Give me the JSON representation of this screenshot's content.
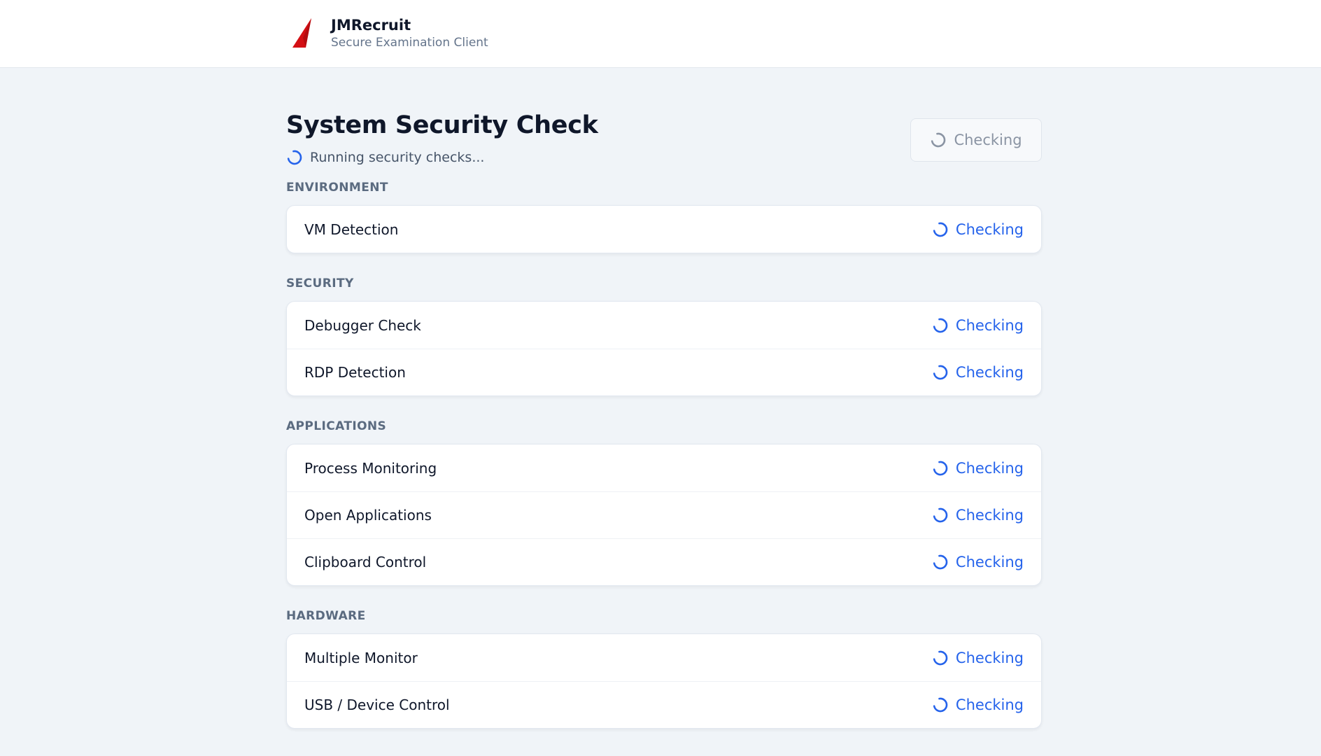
{
  "app": {
    "name": "JMRecruit",
    "subtitle": "Secure Examination Client",
    "logo_color": "#d40f14"
  },
  "page": {
    "title": "System Security Check",
    "status_text": "Running security checks...",
    "check_button_label": "Checking"
  },
  "colors": {
    "accent": "#2563eb",
    "muted": "#8a94a3"
  },
  "sections": [
    {
      "title": "ENVIRONMENT",
      "items": [
        {
          "label": "VM Detection",
          "status": "Checking"
        }
      ]
    },
    {
      "title": "SECURITY",
      "items": [
        {
          "label": "Debugger Check",
          "status": "Checking"
        },
        {
          "label": "RDP Detection",
          "status": "Checking"
        }
      ]
    },
    {
      "title": "APPLICATIONS",
      "items": [
        {
          "label": "Process Monitoring",
          "status": "Checking"
        },
        {
          "label": "Open Applications",
          "status": "Checking"
        },
        {
          "label": "Clipboard Control",
          "status": "Checking"
        }
      ]
    },
    {
      "title": "HARDWARE",
      "items": [
        {
          "label": "Multiple Monitor",
          "status": "Checking"
        },
        {
          "label": "USB / Device Control",
          "status": "Checking"
        }
      ]
    }
  ]
}
